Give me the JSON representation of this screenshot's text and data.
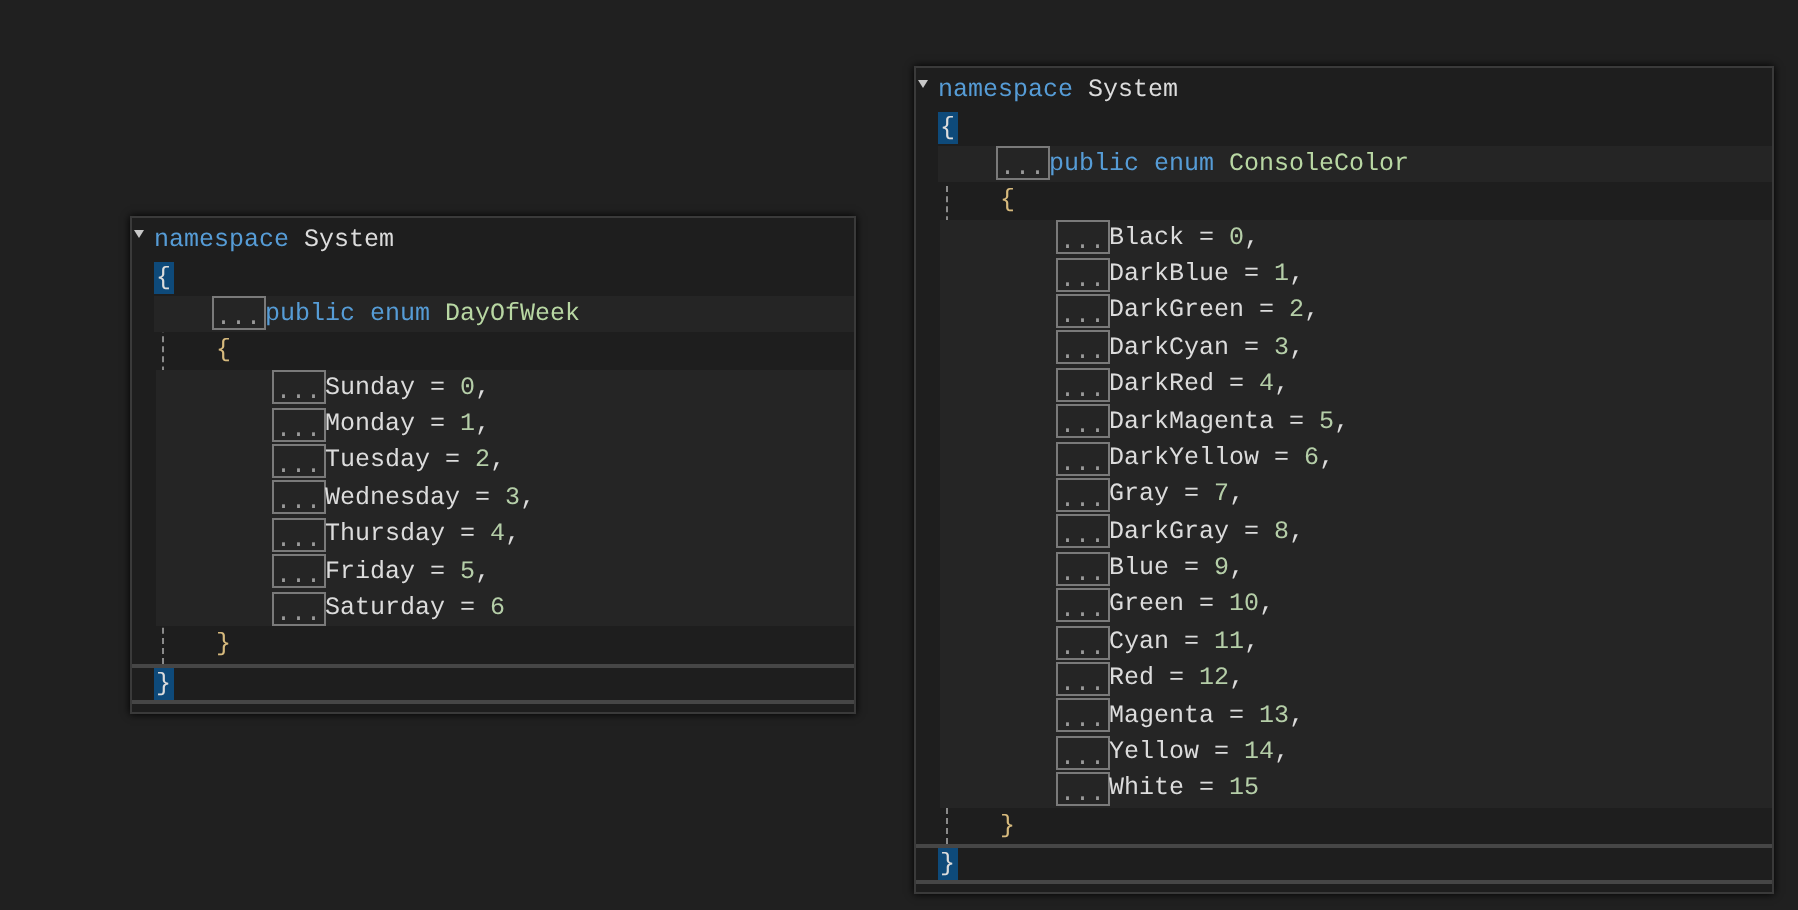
{
  "editors": [
    {
      "namespace_keyword": "namespace",
      "namespace_name": "System",
      "open_brace": "{",
      "enum": {
        "marker": "...",
        "keywords": "public enum",
        "name": "DayOfWeek",
        "open_brace": "{",
        "members": [
          {
            "marker": "...",
            "name": "Sunday",
            "operator": "=",
            "value": "0",
            "separator": ","
          },
          {
            "marker": "...",
            "name": "Monday",
            "operator": "=",
            "value": "1",
            "separator": ","
          },
          {
            "marker": "...",
            "name": "Tuesday",
            "operator": "=",
            "value": "2",
            "separator": ","
          },
          {
            "marker": "...",
            "name": "Wednesday",
            "operator": "=",
            "value": "3",
            "separator": ","
          },
          {
            "marker": "...",
            "name": "Thursday",
            "operator": "=",
            "value": "4",
            "separator": ","
          },
          {
            "marker": "...",
            "name": "Friday",
            "operator": "=",
            "value": "5",
            "separator": ","
          },
          {
            "marker": "...",
            "name": "Saturday",
            "operator": "=",
            "value": "6"
          }
        ],
        "close_brace": "}"
      },
      "close_brace": "}"
    },
    {
      "namespace_keyword": "namespace",
      "namespace_name": "System",
      "open_brace": "{",
      "enum": {
        "marker": "...",
        "keywords": "public enum",
        "name": "ConsoleColor",
        "open_brace": "{",
        "members": [
          {
            "marker": "...",
            "name": "Black",
            "operator": "=",
            "value": "0",
            "separator": ","
          },
          {
            "marker": "...",
            "name": "DarkBlue",
            "operator": "=",
            "value": "1",
            "separator": ","
          },
          {
            "marker": "...",
            "name": "DarkGreen",
            "operator": "=",
            "value": "2",
            "separator": ","
          },
          {
            "marker": "...",
            "name": "DarkCyan",
            "operator": "=",
            "value": "3",
            "separator": ","
          },
          {
            "marker": "...",
            "name": "DarkRed",
            "operator": "=",
            "value": "4",
            "separator": ","
          },
          {
            "marker": "...",
            "name": "DarkMagenta",
            "operator": "=",
            "value": "5",
            "separator": ","
          },
          {
            "marker": "...",
            "name": "DarkYellow",
            "operator": "=",
            "value": "6",
            "separator": ","
          },
          {
            "marker": "...",
            "name": "Gray",
            "operator": "=",
            "value": "7",
            "separator": ","
          },
          {
            "marker": "...",
            "name": "DarkGray",
            "operator": "=",
            "value": "8",
            "separator": ","
          },
          {
            "marker": "...",
            "name": "Blue",
            "operator": "=",
            "value": "9",
            "separator": ","
          },
          {
            "marker": "...",
            "name": "Green",
            "operator": "=",
            "value": "10",
            "separator": ","
          },
          {
            "marker": "...",
            "name": "Cyan",
            "operator": "=",
            "value": "11",
            "separator": ","
          },
          {
            "marker": "...",
            "name": "Red",
            "operator": "=",
            "value": "12",
            "separator": ","
          },
          {
            "marker": "...",
            "name": "Magenta",
            "operator": "=",
            "value": "13",
            "separator": ","
          },
          {
            "marker": "...",
            "name": "Yellow",
            "operator": "=",
            "value": "14",
            "separator": ","
          },
          {
            "marker": "...",
            "name": "White",
            "operator": "=",
            "value": "15"
          }
        ],
        "close_brace": "}"
      },
      "close_brace": "}"
    }
  ]
}
